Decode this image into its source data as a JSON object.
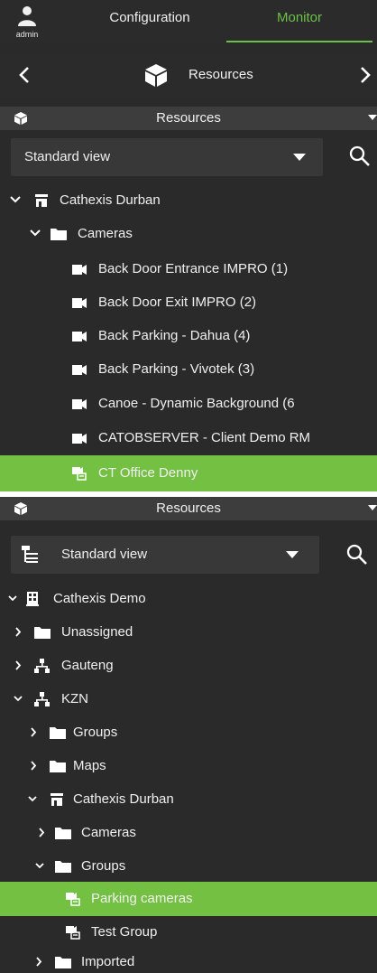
{
  "top_tabs": {
    "user": "admin",
    "configuration": "Configuration",
    "monitor": "Monitor"
  },
  "nav": {
    "title": "Resources"
  },
  "panel1": {
    "header": "Resources",
    "view_select": "Standard view",
    "tree": {
      "site": "Cathexis Durban",
      "folder": "Cameras",
      "cameras": [
        "Back Door Entrance IMPRO (1)",
        "Back Door Exit IMPRO (2)",
        "Back Parking - Dahua (4)",
        "Back Parking - Vivotek (3)",
        "Canoe - Dynamic Background (6",
        "CATOBSERVER - Client Demo RM"
      ],
      "selected_group": "CT Office Denny"
    }
  },
  "panel2": {
    "header": "Resources",
    "view_select": "Standard view",
    "tree": {
      "root": "Cathexis Demo",
      "unassigned": "Unassigned",
      "gauteng": "Gauteng",
      "kzn": "KZN",
      "kzn_groups": "Groups",
      "kzn_maps": "Maps",
      "site": "Cathexis Durban",
      "site_cameras": "Cameras",
      "site_groups": "Groups",
      "group_parking": "Parking cameras",
      "group_test": "Test Group",
      "imported": "Imported"
    }
  },
  "colors": {
    "accent": "#6cc04a",
    "selected_row": "#74c043",
    "panel_bg": "#2a2a2a",
    "header_bg": "#3d3d3d"
  }
}
